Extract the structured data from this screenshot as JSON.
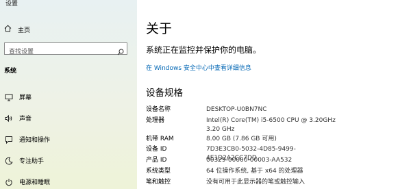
{
  "window": {
    "title": "设置"
  },
  "sidebar": {
    "home_label": "主页",
    "search_placeholder": "查找设置",
    "section_label": "系统",
    "items": [
      {
        "label": "屏幕",
        "icon": "monitor-icon"
      },
      {
        "label": "声音",
        "icon": "speaker-icon"
      },
      {
        "label": "通知和操作",
        "icon": "notification-icon"
      },
      {
        "label": "专注助手",
        "icon": "moon-icon"
      },
      {
        "label": "电源和睡眠",
        "icon": "power-icon"
      }
    ]
  },
  "main": {
    "title": "关于",
    "protect_text": "系统正在监控并保护你的电脑。",
    "security_link": "在 Windows 安全中心中查看详细信息",
    "specs_title": "设备规格",
    "specs": [
      {
        "key": "设备名称",
        "value": "DESKTOP-U0BN7NC"
      },
      {
        "key": "处理器",
        "value": "Intel(R) Core(TM) i5-6500 CPU @ 3.20GHz   3.20 GHz"
      },
      {
        "key": "机带 RAM",
        "value": "8.00 GB (7.86 GB 可用)"
      },
      {
        "key": "设备 ID",
        "value": "7D3E3CB0-5032-4D85-9499-4E1D2A2CC7DD"
      },
      {
        "key": "产品 ID",
        "value": "00329-00000-00003-AA532"
      },
      {
        "key": "系统类型",
        "value": "64 位操作系统, 基于 x64 的处理器"
      },
      {
        "key": "笔和触控",
        "value": "没有可用于此显示器的笔或触控输入"
      }
    ]
  }
}
